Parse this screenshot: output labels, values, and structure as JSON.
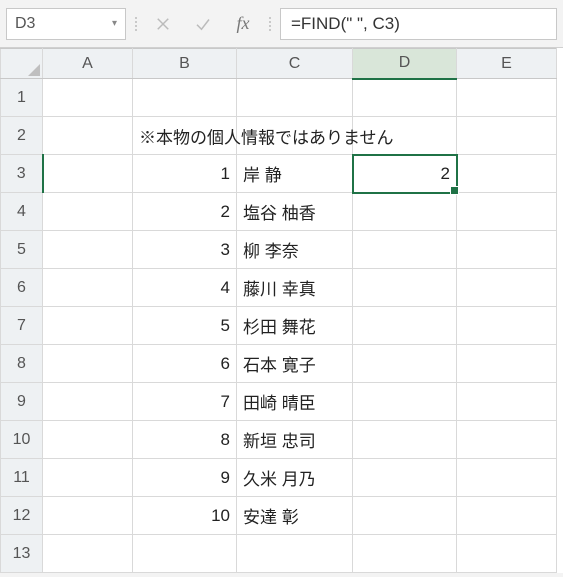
{
  "name_box": {
    "value": "D3"
  },
  "formula": "=FIND(\" \", C3)",
  "columns": [
    "A",
    "B",
    "C",
    "D",
    "E"
  ],
  "rows": [
    "1",
    "2",
    "3",
    "4",
    "5",
    "6",
    "7",
    "8",
    "9",
    "10",
    "11",
    "12",
    "13"
  ],
  "note": "※本物の個人情報ではありません",
  "data": {
    "B": [
      "1",
      "2",
      "3",
      "4",
      "5",
      "6",
      "7",
      "8",
      "9",
      "10"
    ],
    "C": [
      "岸 静",
      "塩谷 柚香",
      "柳 李奈",
      "藤川 幸真",
      "杉田 舞花",
      "石本 寛子",
      "田崎 晴臣",
      "新垣 忠司",
      "久米 月乃",
      "安達 彰"
    ]
  },
  "selected_value": "2",
  "selected_cell": "D3",
  "fx_label": "fx"
}
